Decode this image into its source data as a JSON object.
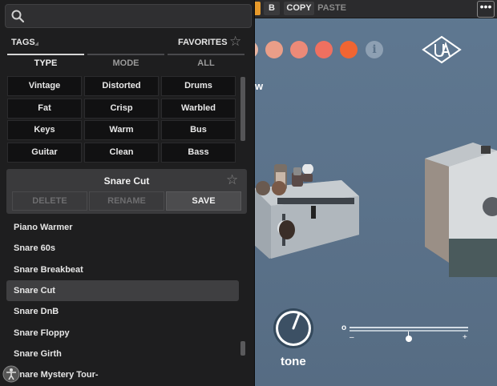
{
  "toolbar": {
    "b_label": "B",
    "copy_label": "COPY",
    "paste_label": "PASTE",
    "more_label": "•••"
  },
  "plugin": {
    "color_dots": [
      "#e8b6a4",
      "#ea9e88",
      "#ec8a78",
      "#ef7060",
      "#f06532"
    ],
    "info_label": "i",
    "partial_label": "w",
    "knob_label": "tone",
    "slider": {
      "left_label": "o",
      "minus_label": "–",
      "plus_label": "+",
      "value_fraction": 0.5
    }
  },
  "browser": {
    "search": {
      "value": "",
      "placeholder": ""
    },
    "tags_label": "TAGS",
    "favorites_label": "FAVORITES",
    "tabs": [
      {
        "label": "TYPE",
        "active": true
      },
      {
        "label": "MODE",
        "active": false
      },
      {
        "label": "ALL",
        "active": false
      }
    ],
    "tags": [
      [
        "Vintage",
        "Distorted",
        "Drums"
      ],
      [
        "Fat",
        "Crisp",
        "Warbled"
      ],
      [
        "Keys",
        "Warm",
        "Bus"
      ],
      [
        "Guitar",
        "Clean",
        "Bass"
      ]
    ],
    "current_preset": {
      "name": "Snare Cut",
      "delete_label": "DELETE",
      "rename_label": "RENAME",
      "save_label": "SAVE"
    },
    "presets": [
      {
        "name": "Piano Warmer",
        "selected": false
      },
      {
        "name": "Snare 60s",
        "selected": false
      },
      {
        "name": "Snare Breakbeat",
        "selected": false
      },
      {
        "name": "Snare Cut",
        "selected": true
      },
      {
        "name": "Snare DnB",
        "selected": false
      },
      {
        "name": "Snare Floppy",
        "selected": false
      },
      {
        "name": "Snare Girth",
        "selected": false
      },
      {
        "name": "Snare Mystery Tour-",
        "selected": false
      }
    ]
  }
}
